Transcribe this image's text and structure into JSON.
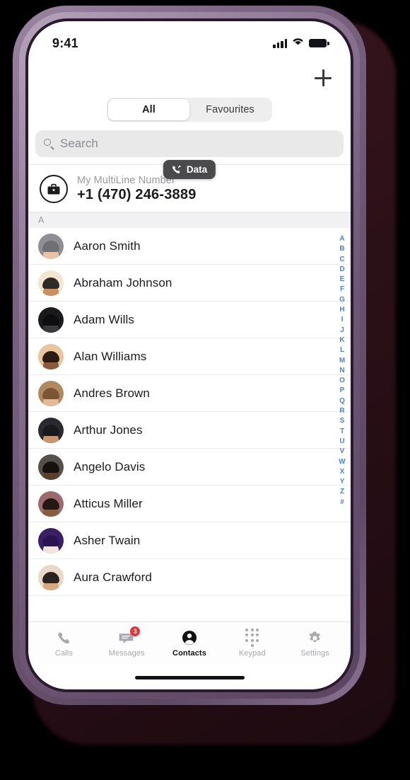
{
  "device": {
    "bezel_color": "#7d6685",
    "shadow_color": "#2c1018"
  },
  "status_bar": {
    "time": "9:41",
    "signal_icon": "cellular-signal-icon",
    "wifi_icon": "wifi-icon",
    "battery_icon": "battery-full-icon"
  },
  "nav": {
    "add_icon": "plus-icon"
  },
  "segmented_control": {
    "options": [
      {
        "label": "All",
        "active": true
      },
      {
        "label": "Favourites",
        "active": false
      }
    ]
  },
  "search": {
    "placeholder": "Search",
    "value": "",
    "icon": "search-icon"
  },
  "data_badge": {
    "label": "Data",
    "icon": "phone-data-icon",
    "background": "#4a4a4c"
  },
  "my_number": {
    "icon": "briefcase-icon",
    "label": "My MultiLine Number",
    "value": "+1 (470) 246-3889"
  },
  "contacts": {
    "section_header": "A",
    "items": [
      {
        "name": "Aaron Smith",
        "avatar": "photo-avatar",
        "bg": "#8e8e93",
        "skin": "#e9c3a4",
        "hair": "#6f6f74",
        "body": "#f0efee"
      },
      {
        "name": "Abraham Johnson",
        "avatar": "photo-avatar",
        "bg": "#f2e6cf",
        "skin": "#c98f63",
        "hair": "#2e2a28",
        "body": "#2f79a8"
      },
      {
        "name": "Adam Wills",
        "avatar": "photo-avatar",
        "bg": "#1b1b1d",
        "skin": "#3a3a3d",
        "hair": "#0e0e10",
        "body": "#242427"
      },
      {
        "name": "Alan Williams",
        "avatar": "photo-avatar",
        "bg": "#e8c59a",
        "skin": "#8a5a3a",
        "hair": "#2a1c14",
        "body": "#3b4a58"
      },
      {
        "name": "Andres Brown",
        "avatar": "photo-avatar",
        "bg": "#b08a5e",
        "skin": "#e3b896",
        "hair": "#7b5535",
        "body": "#cfcfcf"
      },
      {
        "name": "Arthur Jones",
        "avatar": "photo-avatar",
        "bg": "#2a2a2e",
        "skin": "#c99672",
        "hair": "#1a1a1c",
        "body": "#6a4a38"
      },
      {
        "name": "Angelo Davis",
        "avatar": "photo-avatar",
        "bg": "#55504a",
        "skin": "#5a3f2c",
        "hair": "#17110d",
        "body": "#3e3a34"
      },
      {
        "name": "Atticus Miller",
        "avatar": "photo-avatar",
        "bg": "#9c6a6e",
        "skin": "#8a5c3e",
        "hair": "#241814",
        "body": "#5b7fa6"
      },
      {
        "name": "Asher Twain",
        "avatar": "photo-avatar",
        "bg": "#3a1f64",
        "skin": "#f0e4dc",
        "hair": "#2a1450",
        "body": "#e8ddd6"
      },
      {
        "name": "Aura Crawford",
        "avatar": "photo-avatar",
        "bg": "#e7d9c6",
        "skin": "#d9a87e",
        "hair": "#2a2420",
        "body": "#e98f8f"
      }
    ]
  },
  "alpha_index": {
    "letters": [
      "A",
      "B",
      "C",
      "D",
      "E",
      "F",
      "G",
      "H",
      "I",
      "J",
      "K",
      "L",
      "M",
      "N",
      "O",
      "P",
      "Q",
      "R",
      "S",
      "T",
      "U",
      "V",
      "W",
      "X",
      "Y",
      "Z",
      "#"
    ],
    "color": "#4a7fe0"
  },
  "tab_bar": {
    "tabs": [
      {
        "label": "Calls",
        "icon": "phone-icon",
        "active": false,
        "badge": ""
      },
      {
        "label": "Messages",
        "icon": "message-icon",
        "active": false,
        "badge": "3"
      },
      {
        "label": "Contacts",
        "icon": "person-icon",
        "active": true,
        "badge": ""
      },
      {
        "label": "Keypad",
        "icon": "keypad-icon",
        "active": false,
        "badge": ""
      },
      {
        "label": "Settings",
        "icon": "gear-icon",
        "active": false,
        "badge": ""
      }
    ]
  },
  "home_indicator": {
    "present": true
  }
}
